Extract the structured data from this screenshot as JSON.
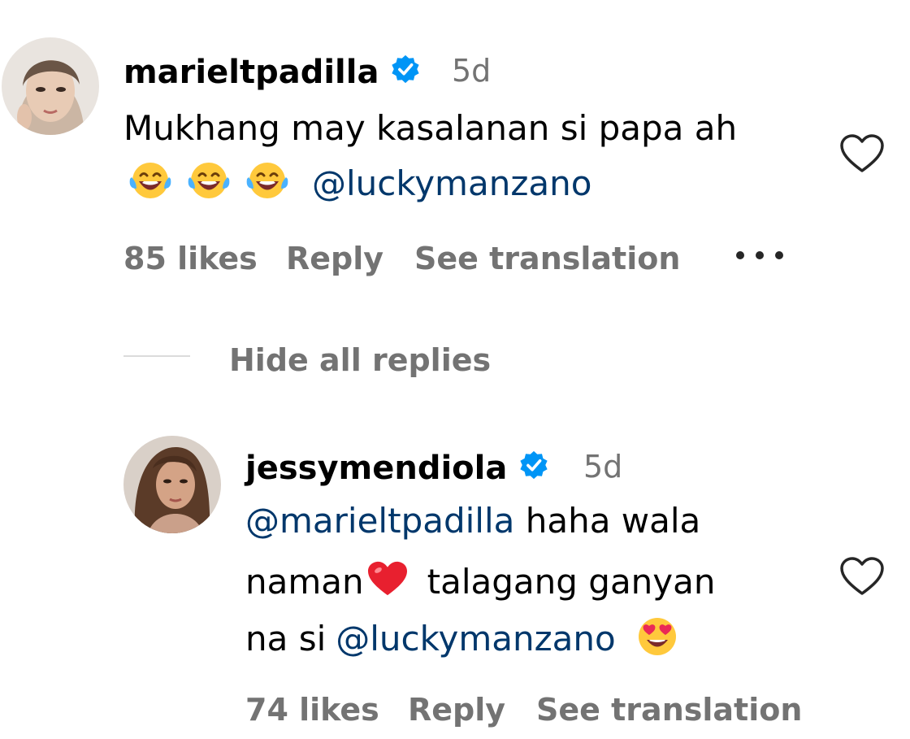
{
  "comments": [
    {
      "username": "marieltpadilla",
      "time": "5d",
      "line1": "Mukhang may kasalanan si papa ah",
      "line2_emojis": [
        "face-with-tears-of-joy",
        "face-with-tears-of-joy",
        "face-with-tears-of-joy"
      ],
      "line2_mention": "@luckymanzano",
      "likes": "85 likes",
      "reply": "Reply",
      "translation": "See translation"
    }
  ],
  "replies_toggle": "Hide all replies",
  "replies": [
    {
      "username": "jessymendiola",
      "time": "5d",
      "line1_mention": "@marieltpadilla",
      "line1_text": "haha wala",
      "line2_text_a": "naman",
      "line2_emoji": "red-heart",
      "line2_text_b": "talagang ganyan",
      "line3_text": "na si",
      "line3_mention": "@luckymanzano",
      "line3_emoji": "smiling-face-with-heart-eyes",
      "likes": "74 likes",
      "reply": "Reply",
      "translation": "See translation"
    }
  ],
  "colors": {
    "verified": "#0095f6",
    "mention": "#00376b",
    "muted": "#737373"
  }
}
